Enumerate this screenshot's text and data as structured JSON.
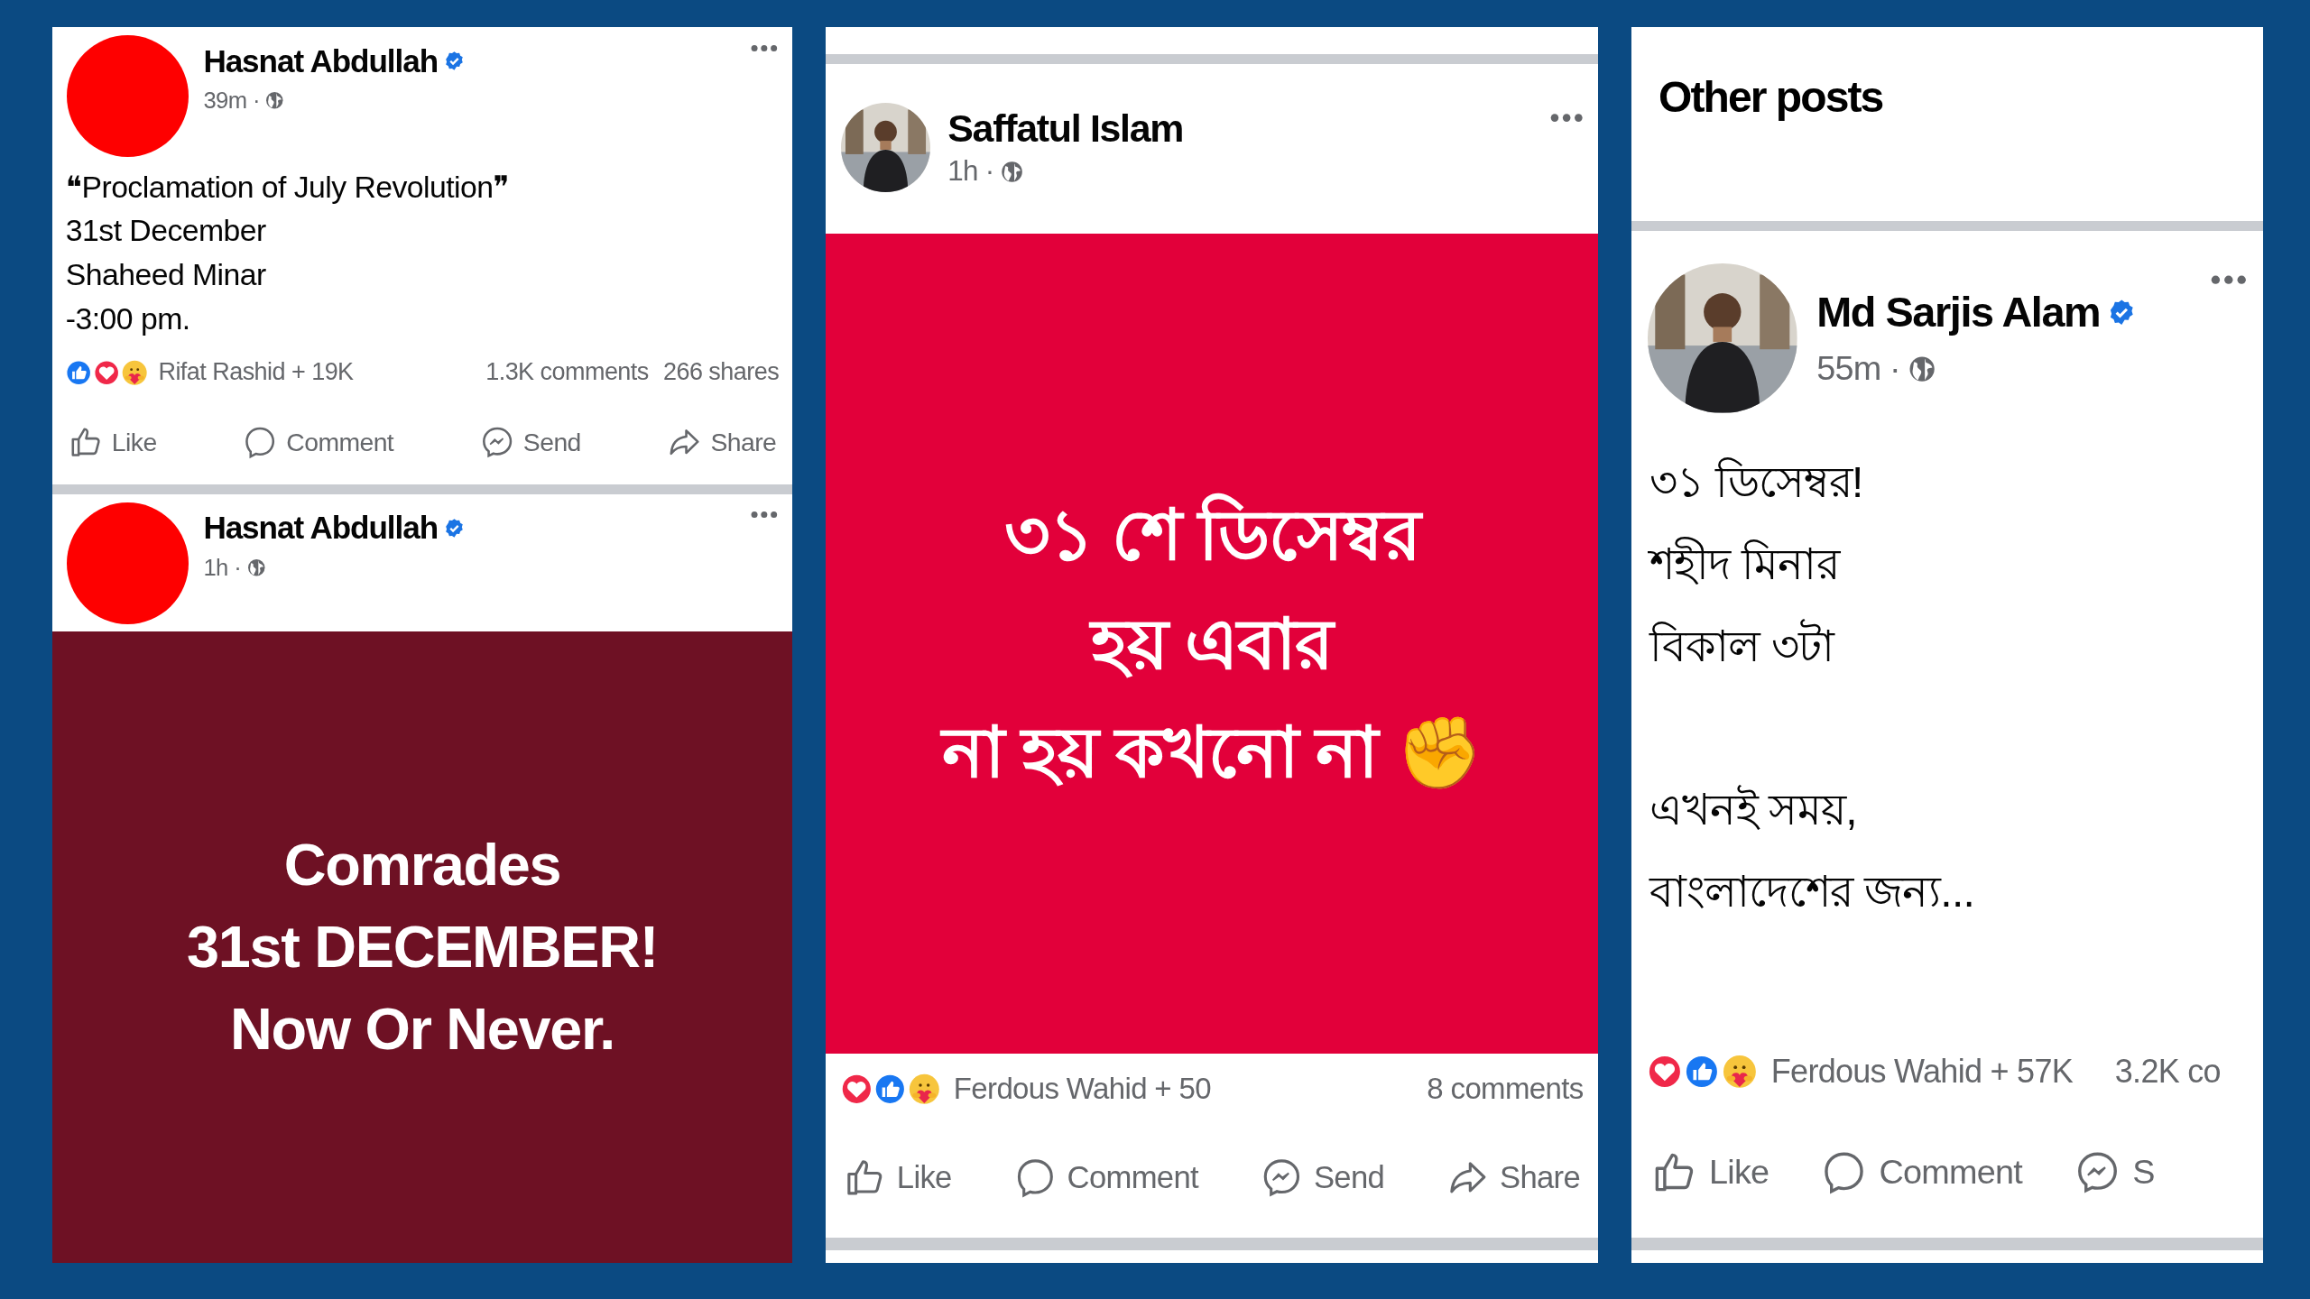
{
  "panels": [
    {
      "kind": "feed",
      "posts": [
        {
          "author": "Hasnat Abdullah",
          "verified": true,
          "time": "39m",
          "separator": "·",
          "avatar": {
            "kind": "plain",
            "color": "#fe0000"
          },
          "text": [
            "❝Proclamation of July Revolution❞\n31st December\nShaheed Minar\n-3:00 pm."
          ],
          "reactions": [
            {
              "kind": "like"
            },
            {
              "kind": "love"
            },
            {
              "kind": "care"
            }
          ],
          "reactors": "Rifat Rashid + 19K",
          "comments": "1.3K comments",
          "shares": "266 shares",
          "actions": [
            {
              "kind": "like",
              "label": "Like"
            },
            {
              "kind": "comment",
              "label": "Comment"
            },
            {
              "kind": "send",
              "label": "Send"
            },
            {
              "kind": "share",
              "label": "Share"
            }
          ]
        },
        {
          "author": "Hasnat Abdullah",
          "verified": true,
          "time": "1h",
          "separator": "·",
          "avatar": {
            "kind": "plain",
            "color": "#fe0000"
          },
          "image": {
            "kind": "text-card",
            "color": "#6e1124",
            "text": "Comrades\n31st DECEMBER!\nNow Or Never."
          }
        }
      ]
    },
    {
      "kind": "feed",
      "posts": [
        {
          "author": "Saffatul Islam",
          "verified": false,
          "time": "1h",
          "separator": "·",
          "avatar": {
            "kind": "picture"
          },
          "image": {
            "kind": "text-card",
            "color": "#e2003a",
            "text": "৩১ শে ডিসেম্বর\nহয় এবার\nনা হয় কখনো না ✊"
          },
          "reactions": [
            {
              "kind": "love"
            },
            {
              "kind": "like"
            },
            {
              "kind": "care"
            }
          ],
          "reactors": "Ferdous Wahid + 50",
          "comments": "8 comments",
          "actions": [
            {
              "kind": "like",
              "label": "Like"
            },
            {
              "kind": "comment",
              "label": "Comment"
            },
            {
              "kind": "send",
              "label": "Send"
            },
            {
              "kind": "share",
              "label": "Share"
            }
          ]
        }
      ]
    },
    {
      "kind": "other",
      "heading": "Other posts",
      "posts": [
        {
          "author": "Md Sarjis Alam",
          "verified": true,
          "time": "55m",
          "separator": "·",
          "avatar": {
            "kind": "picture"
          },
          "text": [
            "৩১ ডিসেম্বর!\nশহীদ মিনার\nবিকাল ৩টা",
            "এখনই সময়,\nবাংলাদেশের জন্য..."
          ],
          "reactions": [
            {
              "kind": "love"
            },
            {
              "kind": "like"
            },
            {
              "kind": "care"
            }
          ],
          "reactors": "Ferdous Wahid + 57K",
          "comments": "3.2K co",
          "actions": [
            {
              "kind": "like",
              "label": "Like"
            },
            {
              "kind": "comment",
              "label": "Comment"
            },
            {
              "kind": "send",
              "label": "S"
            }
          ]
        }
      ]
    }
  ]
}
